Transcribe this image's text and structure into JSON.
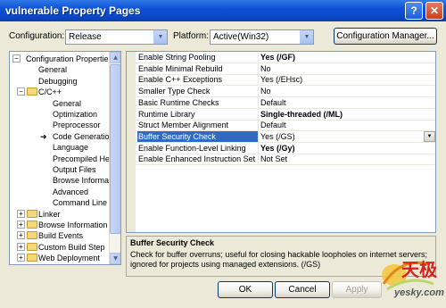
{
  "window": {
    "title": "vulnerable Property Pages"
  },
  "top": {
    "configuration_label": "Configuration:",
    "configuration_value": "Release",
    "platform_label": "Platform:",
    "platform_value": "Active(Win32)",
    "config_manager_button": "Configuration Manager..."
  },
  "tree": {
    "items": [
      {
        "label": "Configuration Properties",
        "level": 0,
        "expanded": true,
        "folder": true
      },
      {
        "label": "General",
        "level": 1
      },
      {
        "label": "Debugging",
        "level": 1
      },
      {
        "label": "C/C++",
        "level": 1,
        "expanded": true,
        "folder": true
      },
      {
        "label": "General",
        "level": 2
      },
      {
        "label": "Optimization",
        "level": 2
      },
      {
        "label": "Preprocessor",
        "level": 2
      },
      {
        "label": "Code Generation",
        "level": 2,
        "current": true
      },
      {
        "label": "Language",
        "level": 2
      },
      {
        "label": "Precompiled Headers",
        "level": 2
      },
      {
        "label": "Output Files",
        "level": 2
      },
      {
        "label": "Browse Information",
        "level": 2
      },
      {
        "label": "Advanced",
        "level": 2
      },
      {
        "label": "Command Line",
        "level": 2
      },
      {
        "label": "Linker",
        "level": 1,
        "expanded": false,
        "folder": true
      },
      {
        "label": "Browse Information",
        "level": 1,
        "expanded": false,
        "folder": true
      },
      {
        "label": "Build Events",
        "level": 1,
        "expanded": false,
        "folder": true
      },
      {
        "label": "Custom Build Step",
        "level": 1,
        "expanded": false,
        "folder": true
      },
      {
        "label": "Web Deployment",
        "level": 1,
        "expanded": false,
        "folder": true
      }
    ]
  },
  "properties": [
    {
      "name": "Enable String Pooling",
      "value": "Yes (/GF)",
      "bold": true
    },
    {
      "name": "Enable Minimal Rebuild",
      "value": "No",
      "bold": false
    },
    {
      "name": "Enable C++ Exceptions",
      "value": "Yes (/EHsc)",
      "bold": false
    },
    {
      "name": "Smaller Type Check",
      "value": "No",
      "bold": false
    },
    {
      "name": "Basic Runtime Checks",
      "value": "Default",
      "bold": false
    },
    {
      "name": "Runtime Library",
      "value": "Single-threaded (/ML)",
      "bold": true
    },
    {
      "name": "Struct Member Alignment",
      "value": "Default",
      "bold": false
    },
    {
      "name": "Buffer Security Check",
      "value": "Yes (/GS)",
      "bold": false,
      "selected": true
    },
    {
      "name": "Enable Function-Level Linking",
      "value": "Yes (/Gy)",
      "bold": true
    },
    {
      "name": "Enable Enhanced Instruction Set",
      "value": "Not Set",
      "bold": false
    }
  ],
  "description": {
    "title": "Buffer Security Check",
    "text": "Check for buffer overruns; useful for closing hackable loopholes on internet servers; ignored for projects using managed extensions.     (/GS)"
  },
  "buttons": {
    "ok": "OK",
    "cancel": "Cancel",
    "apply": "Apply"
  },
  "watermark": {
    "brand_chinese": "天极",
    "brand_latin": "yesky.com"
  },
  "colors": {
    "selection": "#316ac5",
    "titlebar": "#0a47c8"
  }
}
